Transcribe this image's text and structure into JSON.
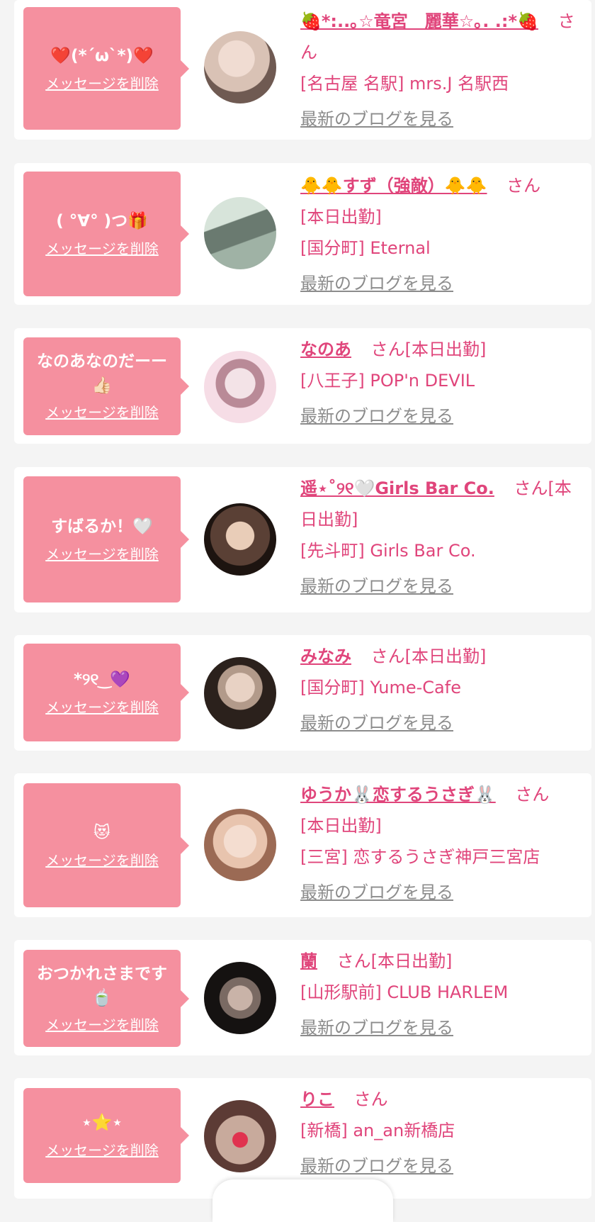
{
  "cards": [
    {
      "message": "❤️(*´ω`*)❤️",
      "delete_label": "メッセージを削除",
      "name": "🍓*:..｡☆竜宮　麗華☆｡. .:*🍓",
      "san": "さん",
      "status": "",
      "shop": "[名古屋 名駅] mrs.J 名駅西",
      "blog_label": "最新のブログを見る",
      "avatar_colors": [
        "#d9c2b5",
        "#6f5a52"
      ]
    },
    {
      "message": "( °∀° )つ🎁",
      "delete_label": "メッセージを削除",
      "name": "🐥🐥すず（強敵）🐥🐥",
      "san": "さん",
      "status": "[本日出勤]",
      "shop": "[国分町] Eternal",
      "blog_label": "最新のブログを見る",
      "avatar_colors": [
        "#9fb2a5",
        "#3d4a45"
      ]
    },
    {
      "message": "なのあなのだーー👍🏻",
      "delete_label": "メッセージを削除",
      "name": "なのあ",
      "san": "さん",
      "status": "[本日出勤]",
      "shop": "[八王子] POP'n DEVIL",
      "blog_label": "最新のブログを見る",
      "avatar_colors": [
        "#f6dde6",
        "#7a4a5a"
      ]
    },
    {
      "message": "すばるか！🤍",
      "delete_label": "メッセージを削除",
      "name": "遥⋆˚୨୧🤍Girls Bar Co.",
      "san": "さん",
      "status": "[本日出勤]",
      "shop": "[先斗町] Girls Bar Co.",
      "blog_label": "最新のブログを見る",
      "avatar_colors": [
        "#5a4035",
        "#1d1410"
      ]
    },
    {
      "message": "*୨୧ ͜ 💜",
      "delete_label": "メッセージを削除",
      "name": "みなみ",
      "san": "さん",
      "status": "[本日出勤]",
      "shop": "[国分町] Yume-Cafe",
      "blog_label": "最新のブログを見る",
      "avatar_colors": [
        "#b29a8a",
        "#2b211c"
      ]
    },
    {
      "message": "😻",
      "delete_label": "メッセージを削除",
      "name": "ゆうか🐰恋するうさぎ🐰",
      "san": "さん",
      "status": "[本日出勤]",
      "shop": "[三宮] 恋するうさぎ神戸三宮店",
      "blog_label": "最新のブログを見る",
      "avatar_colors": [
        "#e8c4ae",
        "#9b6a54"
      ]
    },
    {
      "message": "おつかれさまです🍵",
      "delete_label": "メッセージを削除",
      "name": "蘭",
      "san": "さん",
      "status": "[本日出勤]",
      "shop": "[山形駅前] CLUB HARLEM",
      "blog_label": "最新のブログを見る",
      "avatar_colors": [
        "#7a6a63",
        "#151211"
      ]
    },
    {
      "message": "⋆⭐️⋆",
      "delete_label": "メッセージを削除",
      "name": "りこ",
      "san": "さん",
      "status": "",
      "shop": "[新橋] an_an新橋店",
      "blog_label": "最新のブログを見る",
      "avatar_colors": [
        "#c8aa9c",
        "#5c3b35"
      ]
    }
  ]
}
